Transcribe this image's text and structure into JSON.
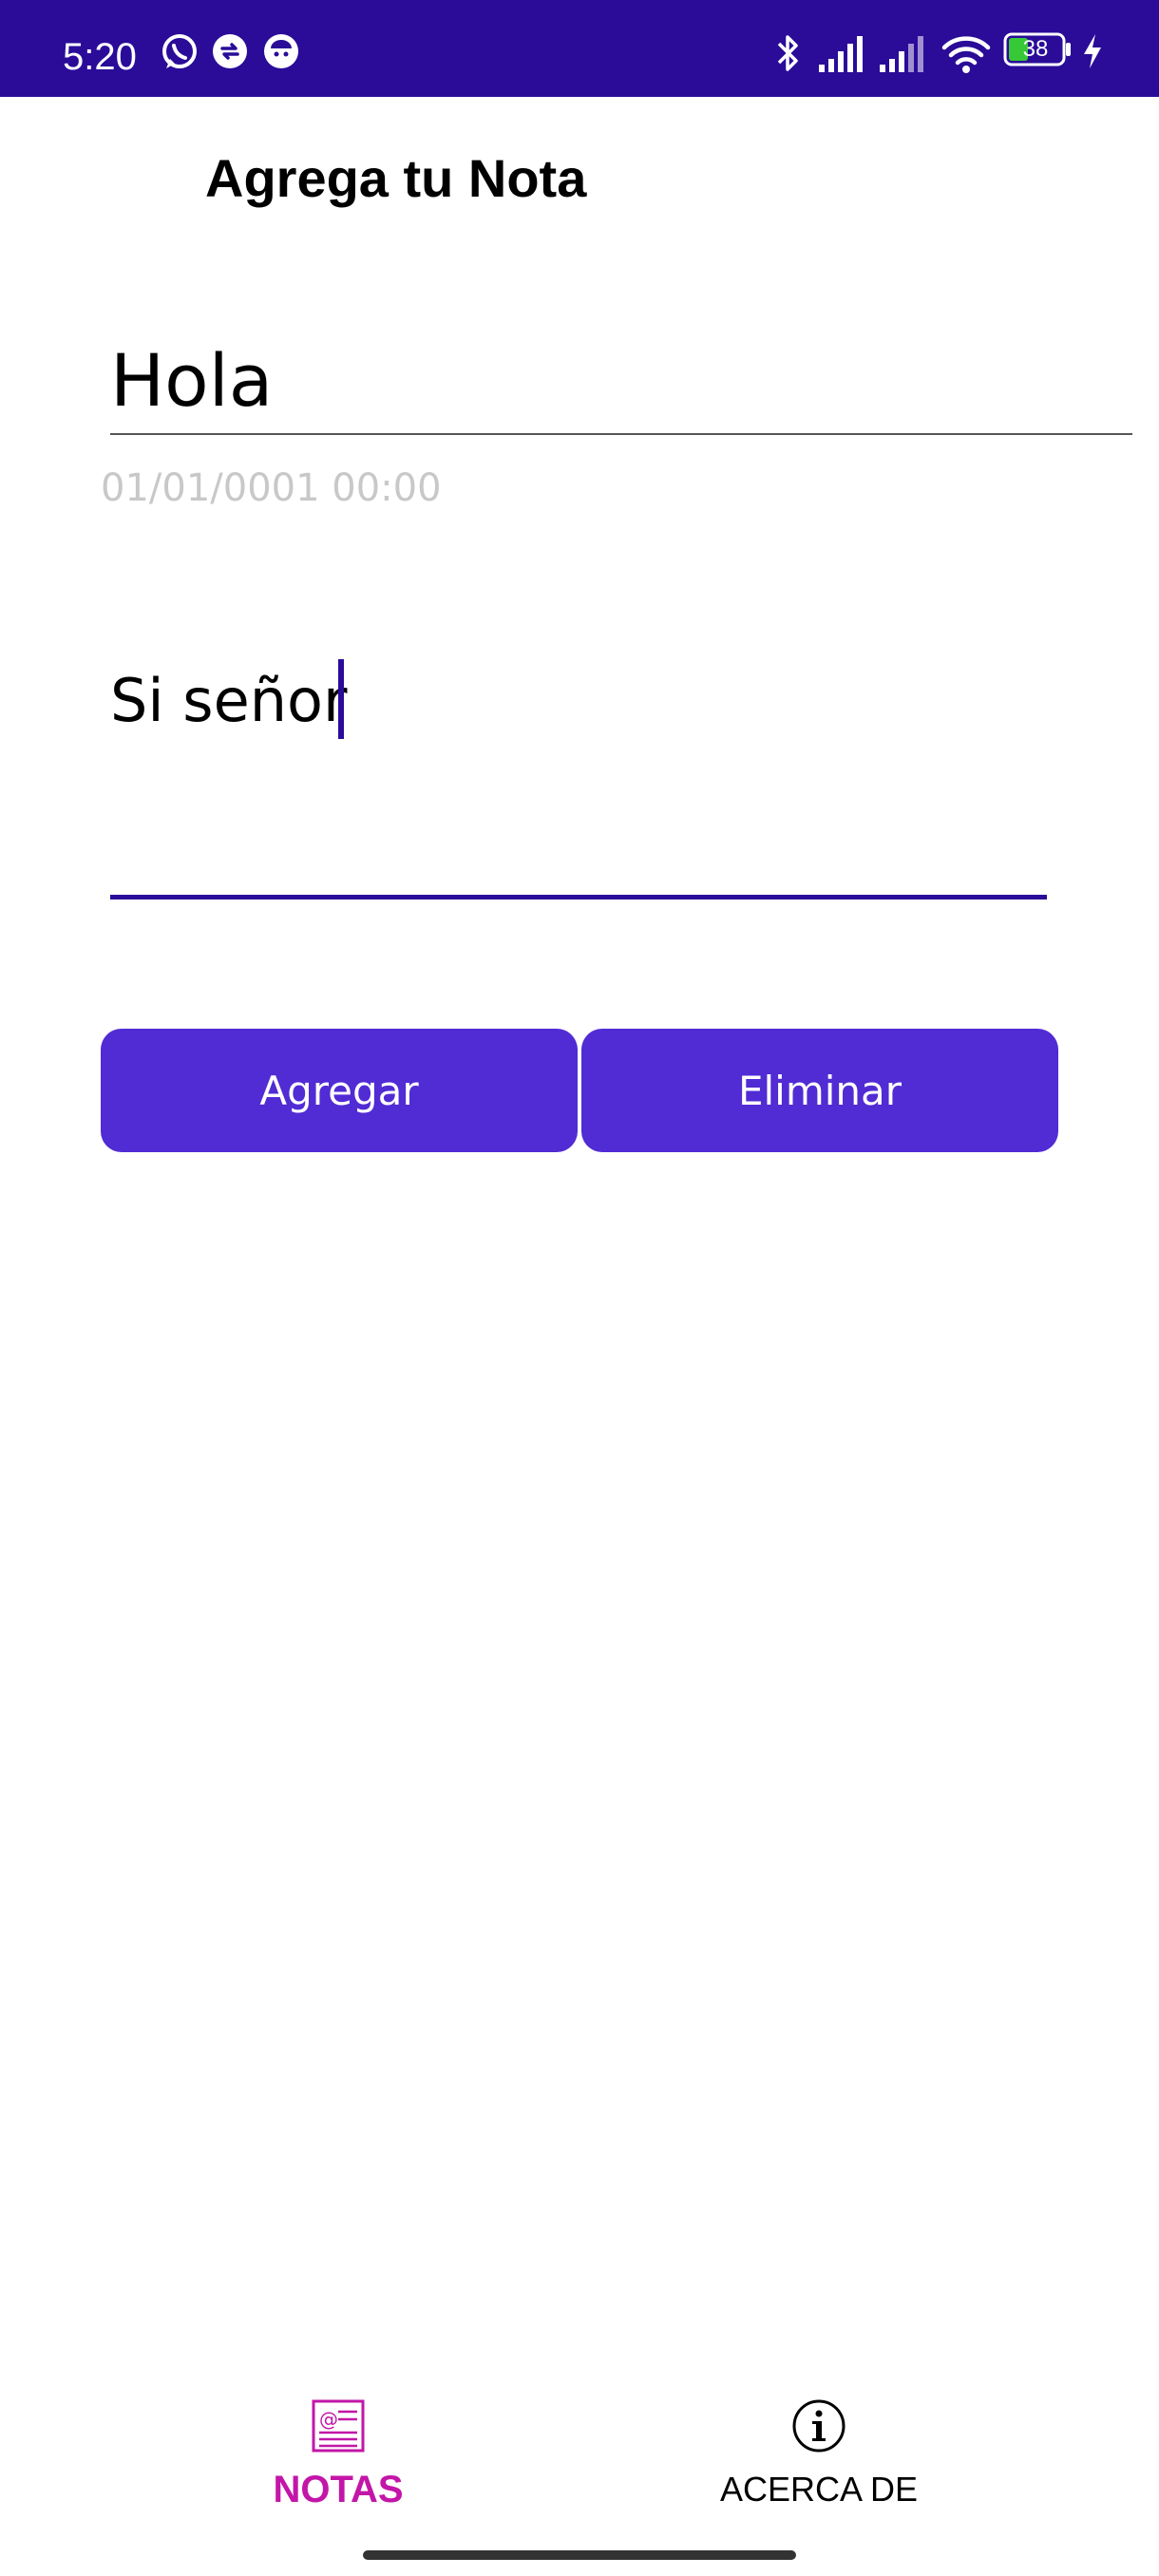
{
  "status_bar": {
    "time": "5:20",
    "battery_level": "38",
    "icons": [
      "whatsapp-icon",
      "sync-app-icon",
      "mascot-app-icon",
      "bluetooth-icon",
      "signal-icon",
      "signal-icon-2",
      "wifi-icon",
      "battery-icon",
      "charging-icon"
    ]
  },
  "page": {
    "title": "Agrega tu Nota"
  },
  "note": {
    "title_value": "Hola",
    "date": "01/01/0001 00:00",
    "body_value": "Si señor"
  },
  "actions": {
    "add_label": "Agregar",
    "delete_label": "Eliminar"
  },
  "tabs": [
    {
      "label": "NOTAS",
      "icon": "notes-icon",
      "selected": true
    },
    {
      "label": "ACERCA DE",
      "icon": "info-icon",
      "selected": false
    }
  ],
  "colors": {
    "status_bar": "#2a0c99",
    "button": "#512bd4",
    "accent_underline": "#2a0c99",
    "selected_tab": "#c316a8",
    "date_text": "#c8c8c8"
  }
}
